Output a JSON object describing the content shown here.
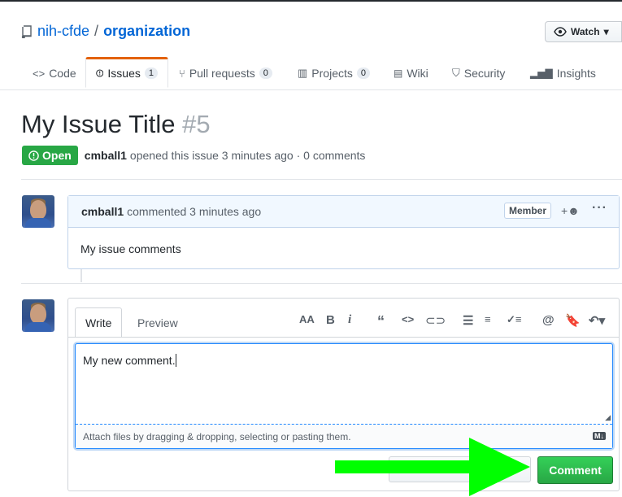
{
  "repo": {
    "owner": "nih-cfde",
    "separator": "/",
    "name": "organization",
    "watch_label": "Watch"
  },
  "tabs": [
    {
      "label": "Code"
    },
    {
      "label": "Issues",
      "count": "1"
    },
    {
      "label": "Pull requests",
      "count": "0"
    },
    {
      "label": "Projects",
      "count": "0"
    },
    {
      "label": "Wiki"
    },
    {
      "label": "Security"
    },
    {
      "label": "Insights"
    }
  ],
  "issue": {
    "title": "My Issue Title",
    "number": "#5",
    "status": "Open",
    "author": "cmball1",
    "meta_text": "opened this issue 3 minutes ago · 0 comments"
  },
  "comment": {
    "author": "cmball1",
    "action": "commented 3 minutes ago",
    "role": "Member",
    "body": "My issue comments"
  },
  "editor": {
    "write_tab": "Write",
    "preview_tab": "Preview",
    "text": "My new comment.",
    "attach_hint": "Attach files by dragging & dropping, selecting or pasting them.",
    "submit_label": "Comment"
  },
  "colors": {
    "accent": "#0366d6",
    "open": "#28a745",
    "arrow": "#00ff00"
  }
}
